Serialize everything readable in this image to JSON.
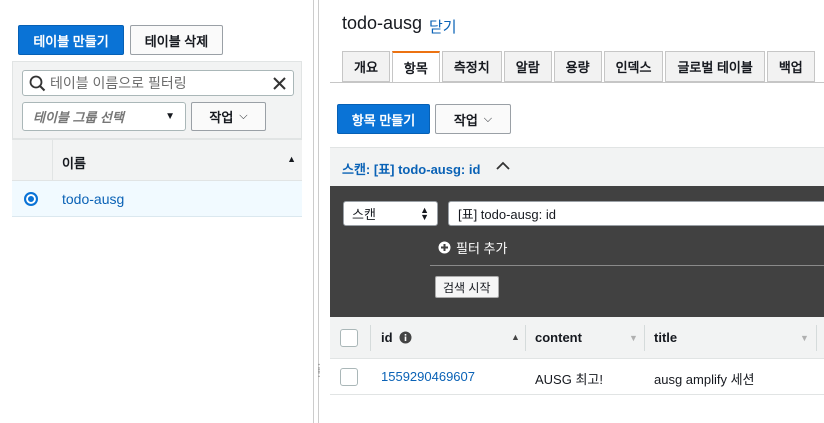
{
  "left": {
    "create_table_label": "테이블 만들기",
    "delete_table_label": "테이블 삭제",
    "search_placeholder": "테이블 이름으로 필터링",
    "group_select_placeholder": "테이블 그룹 선택",
    "actions_label": "작업",
    "column_header": "이름",
    "rows": [
      {
        "name": "todo-ausg",
        "selected": true
      }
    ]
  },
  "right": {
    "table_title": "todo-ausg",
    "close_link": "닫기",
    "tabs": [
      {
        "label": "개요",
        "active": false
      },
      {
        "label": "항목",
        "active": true
      },
      {
        "label": "측정치",
        "active": false
      },
      {
        "label": "알람",
        "active": false
      },
      {
        "label": "용량",
        "active": false
      },
      {
        "label": "인덱스",
        "active": false
      },
      {
        "label": "글로벌 테이블",
        "active": false
      },
      {
        "label": "백업",
        "active": false
      }
    ],
    "create_item_label": "항목 만들기",
    "actions_label": "작업",
    "scan_header": "스캔: [표] todo-ausg: id",
    "scan_select_value": "스캔",
    "scan_target_value": "[표] todo-ausg: id",
    "add_filter_label": "필터 추가",
    "start_search_label": "검색 시작",
    "columns": [
      "id",
      "content",
      "title"
    ],
    "items": [
      {
        "id": "1559290469607",
        "content": "AUSG 최고!",
        "title": "ausg amplify 세션"
      }
    ]
  },
  "colors": {
    "primary": "#0a73d6",
    "tab_active_accent": "#ec7211",
    "link": "#0a62b6",
    "dark_panel": "#414141"
  }
}
